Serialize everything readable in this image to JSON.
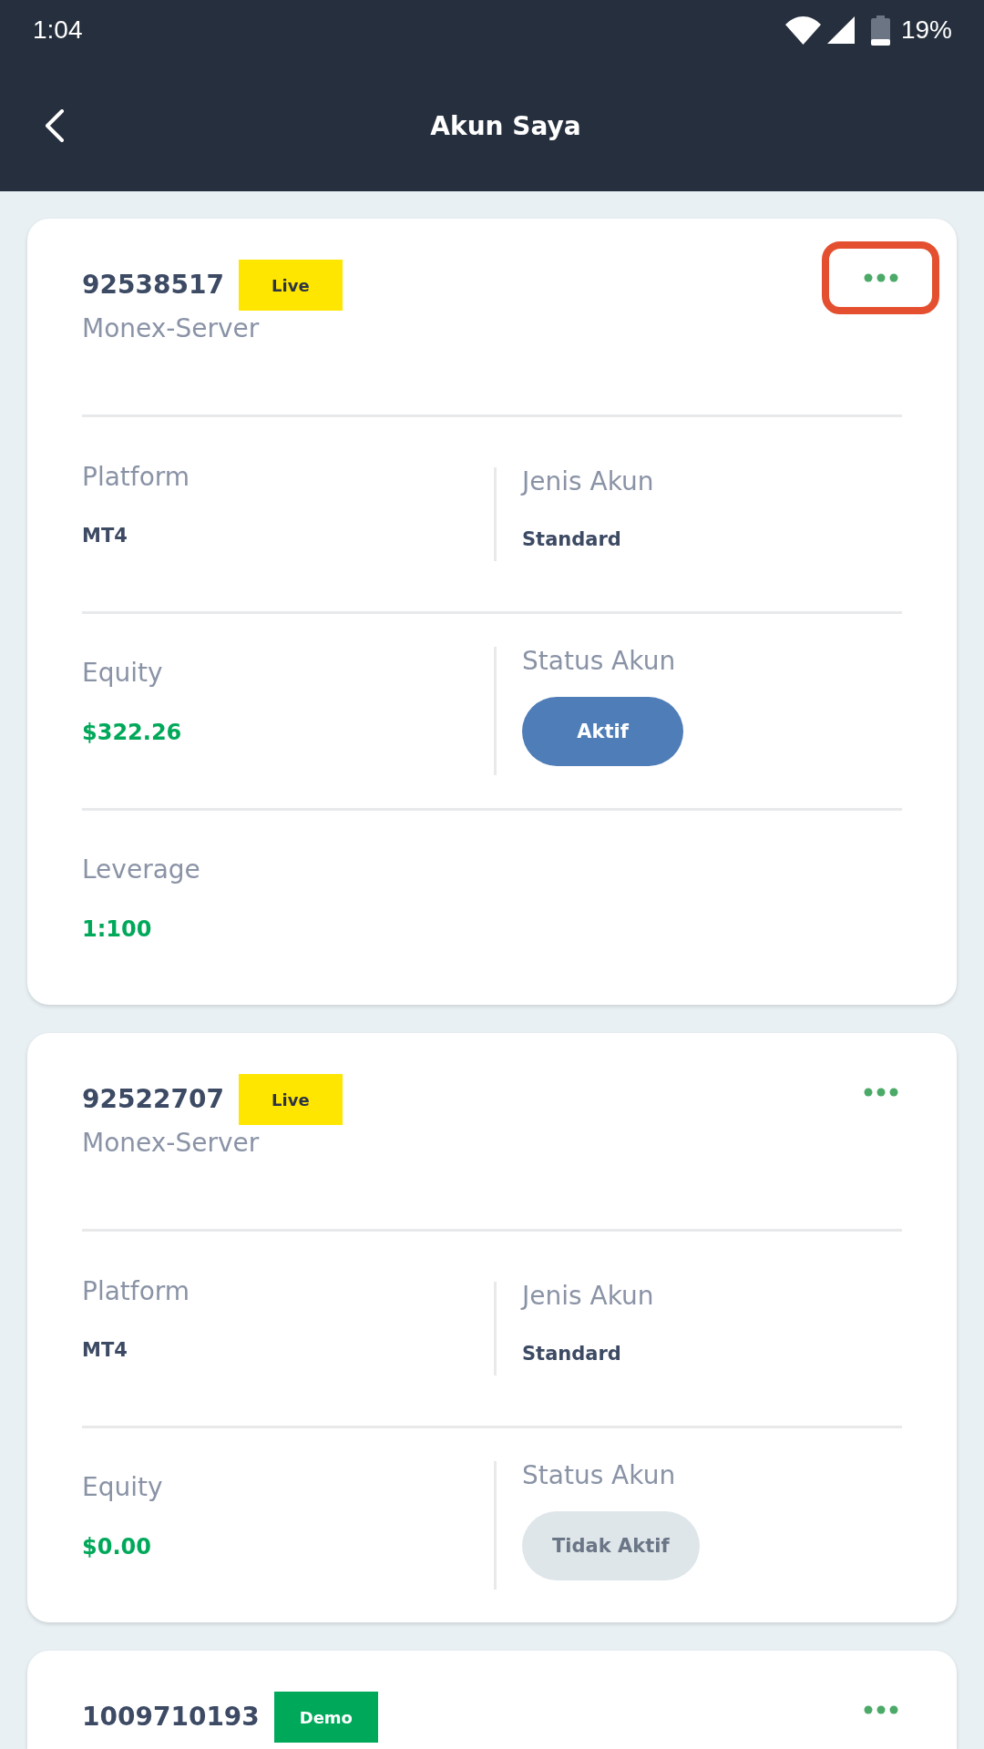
{
  "status_bar": {
    "time": "1:04",
    "battery": "19%"
  },
  "header": {
    "title": "Akun Saya"
  },
  "accounts": [
    {
      "number": "92538517",
      "badge": {
        "label": "Live",
        "kind": "live"
      },
      "server": "Monex-Server",
      "menu_highlighted": true,
      "rows": [
        [
          {
            "kind": "text",
            "label": "Platform",
            "value": "MT4"
          },
          {
            "kind": "text",
            "label": "Jenis Akun",
            "value": "Standard"
          }
        ],
        [
          {
            "kind": "figure",
            "label": "Equity",
            "value": "$322.26"
          },
          {
            "kind": "status",
            "label": "Status Akun",
            "value": "Aktif",
            "active": true
          }
        ],
        [
          {
            "kind": "figure",
            "label": "Leverage",
            "value": "1:100"
          }
        ]
      ]
    },
    {
      "number": "92522707",
      "badge": {
        "label": "Live",
        "kind": "live"
      },
      "server": "Monex-Server",
      "menu_highlighted": false,
      "rows": [
        [
          {
            "kind": "text",
            "label": "Platform",
            "value": "MT4"
          },
          {
            "kind": "text",
            "label": "Jenis Akun",
            "value": "Standard"
          }
        ],
        [
          {
            "kind": "figure",
            "label": "Equity",
            "value": "$0.00"
          },
          {
            "kind": "status",
            "label": "Status Akun",
            "value": "Tidak Aktif",
            "active": false
          }
        ]
      ]
    },
    {
      "number": "1009710193",
      "badge": {
        "label": "Demo",
        "kind": "demo"
      },
      "menu_highlighted": false
    }
  ]
}
